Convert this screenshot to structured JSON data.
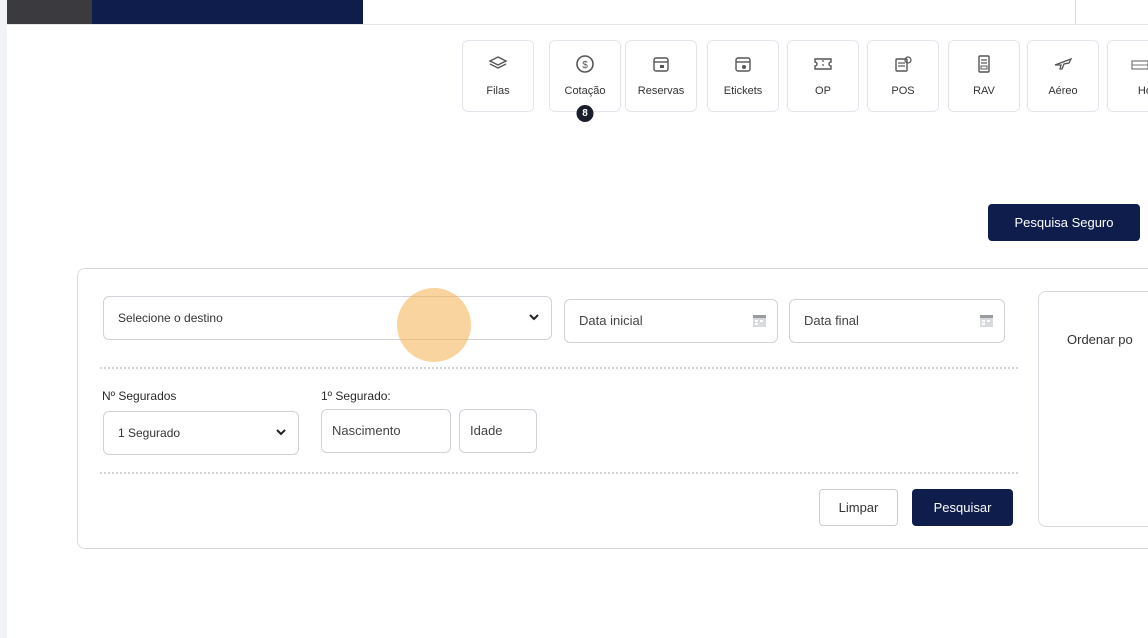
{
  "nav": {
    "items": [
      {
        "label": "Filas",
        "icon": "layers-icon"
      },
      {
        "label": "Cotação",
        "icon": "dollar-coin-icon",
        "badge": "8"
      },
      {
        "label": "Reservas",
        "icon": "calendar-icon"
      },
      {
        "label": "Etickets",
        "icon": "calendar-ticket-icon"
      },
      {
        "label": "OP",
        "icon": "ticket-icon"
      },
      {
        "label": "POS",
        "icon": "pos-icon"
      },
      {
        "label": "RAV",
        "icon": "document-icon"
      },
      {
        "label": "Aéreo",
        "icon": "airplane-icon"
      },
      {
        "label": "Hot",
        "icon": "hotel-icon"
      }
    ]
  },
  "header": {
    "search_insurance_button": "Pesquisa Seguro"
  },
  "form": {
    "destination": {
      "value": "Selecione o destino"
    },
    "start_date": {
      "placeholder": "Data inicial"
    },
    "end_date": {
      "placeholder": "Data final"
    },
    "insured_count": {
      "label": "Nº Segurados",
      "value": "1 Segurado"
    },
    "first_insured": {
      "label": "1º Segurado:",
      "birth_placeholder": "Nascimento",
      "age_placeholder": "Idade"
    },
    "clear_button": "Limpar",
    "search_button": "Pesquisar"
  },
  "sidepanel": {
    "sort_label": "Ordenar po"
  },
  "colors": {
    "navy": "#0f1d4d",
    "dark": "#3b3b3f",
    "click_highlight": "#f5b050"
  }
}
